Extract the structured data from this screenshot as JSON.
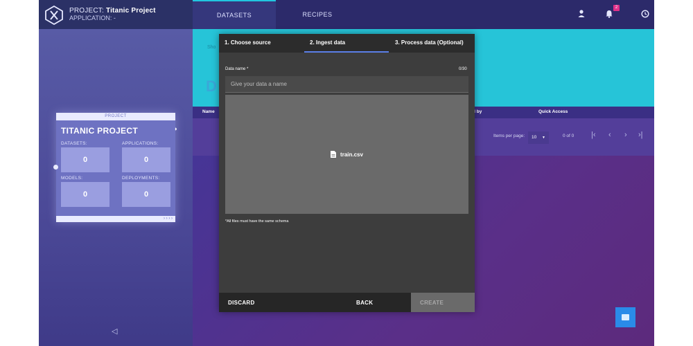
{
  "header": {
    "project_label": "PROJECT:",
    "project_name": "Titanic Project",
    "application_label": "APPLICATION: -"
  },
  "nav": {
    "tabs": [
      {
        "label": "DATASETS",
        "active": true
      },
      {
        "label": "RECIPES",
        "active": false
      }
    ],
    "icons": [
      "user-icon",
      "bell-icon",
      "history-icon",
      "help-icon"
    ],
    "notification_count": "2"
  },
  "sidebar": {
    "card_tag": "PROJECT",
    "card_title": "TITANIC PROJECT",
    "stats": [
      {
        "label": "DATASETS:",
        "value": "0"
      },
      {
        "label": "APPLICATIONS:",
        "value": "0"
      },
      {
        "label": "MODELS:",
        "value": "0"
      },
      {
        "label": "DEPLOYMENTS:",
        "value": "0"
      }
    ],
    "card_footer": "› › › ›",
    "collapse_icon": "◁"
  },
  "table": {
    "columns": [
      "Name",
      "d by",
      "Quick Access"
    ],
    "items_per_page_label": "Items per page:",
    "items_per_page_value": "10",
    "page_count": "0 of 0"
  },
  "modal": {
    "steps": [
      "1. Choose source",
      "2. Ingest data",
      "3. Process data (Optional)"
    ],
    "active_step": 1,
    "field_label": "Data name *",
    "char_count": "0/30",
    "input_placeholder": "Give your data a name",
    "input_value": "",
    "file_name": "train.csv",
    "schema_note": "*All files must have the same schema",
    "buttons": {
      "discard": "DISCARD",
      "back": "BACK",
      "create": "CREATE"
    }
  },
  "colors": {
    "accent_cyan": "#26c4d8",
    "active_step": "#5b7fe8",
    "badge": "#e0308a",
    "fab": "#2a8be8"
  }
}
